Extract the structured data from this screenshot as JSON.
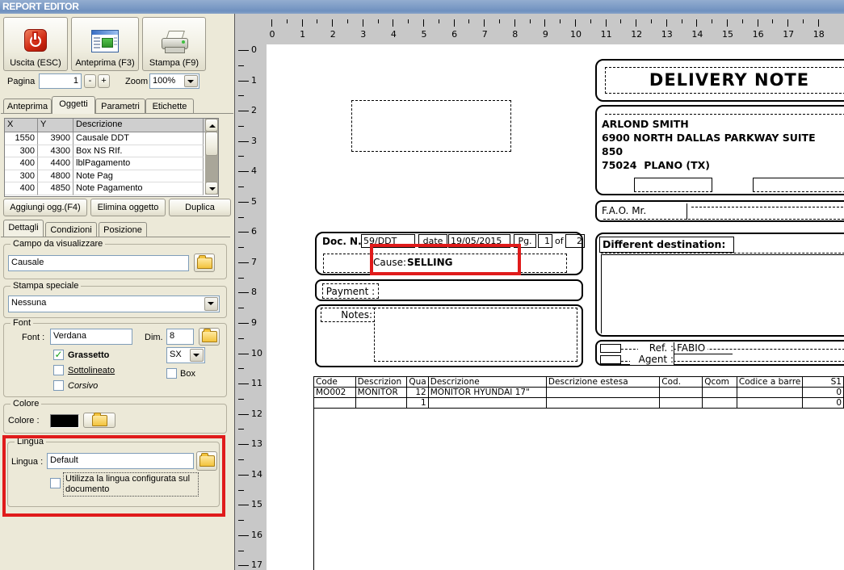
{
  "window": {
    "title": "REPORT EDITOR"
  },
  "toolbar": {
    "buttons": [
      {
        "label": "Uscita (ESC)",
        "icon": "power-icon"
      },
      {
        "label": "Anteprima (F3)",
        "icon": "preview-icon"
      },
      {
        "label": "Stampa (F9)",
        "icon": "printer-icon"
      }
    ]
  },
  "controls": {
    "page_label": "Pagina",
    "page_value": "1",
    "minus_label": "-",
    "plus_label": "+",
    "zoom_label": "Zoom",
    "zoom_value": "100%"
  },
  "object_tabs": {
    "items": [
      "Anteprima",
      "Oggetti",
      "Parametri",
      "Etichette"
    ],
    "active": "Oggetti"
  },
  "objects_table": {
    "columns": [
      "X",
      "Y",
      "Descrizione"
    ],
    "rows": [
      [
        "1550",
        "3900",
        "Causale DDT"
      ],
      [
        "300",
        "4300",
        "Box NS RIf."
      ],
      [
        "400",
        "4400",
        "lblPagamento"
      ],
      [
        "300",
        "4800",
        "Note Pag"
      ],
      [
        "400",
        "4850",
        "Note Pagamento"
      ]
    ]
  },
  "action_buttons": {
    "add": "Aggiungi ogg.(F4)",
    "delete": "Elimina oggetto",
    "duplicate": "Duplica"
  },
  "detail_tabs": {
    "items": [
      "Dettagli",
      "Condizioni",
      "Posizione"
    ],
    "active": "Dettagli"
  },
  "groups": {
    "campo": {
      "title": "Campo da visualizzare",
      "value": "Causale"
    },
    "stampa": {
      "title": "Stampa speciale",
      "value": "Nessuna"
    },
    "font": {
      "title": "Font",
      "font_label": "Font :",
      "font_value": "Verdana",
      "dim_label": "Dim.",
      "dim_value": "8",
      "bold_label": "Grassetto",
      "bold_checked": true,
      "underline_label": "Sottolineato",
      "underline_checked": false,
      "italic_label": "Corsivo",
      "italic_checked": false,
      "align_value": "SX",
      "box_label": "Box",
      "box_checked": false
    },
    "colore": {
      "title": "Colore",
      "label": "Colore :",
      "swatch_color": "#000000"
    },
    "lingua": {
      "title": "Lingua",
      "label": "Lingua :",
      "value": "Default",
      "checkbox_label": "Utilizza la lingua configurata sul documento",
      "checkbox_checked": false
    }
  },
  "rulers": {
    "horizontal_ticks": [
      "0",
      "1",
      "2",
      "3",
      "4",
      "5",
      "6",
      "7",
      "8",
      "9",
      "10",
      "11",
      "12",
      "13",
      "14",
      "15",
      "16",
      "17",
      "18"
    ],
    "vertical_ticks": [
      "0",
      "1",
      "2",
      "3",
      "4",
      "5",
      "6",
      "7",
      "8",
      "9",
      "10",
      "11",
      "12",
      "13",
      "14",
      "15",
      "16",
      "17"
    ]
  },
  "document": {
    "title": "DELIVERY NOTE",
    "address_lines": [
      "ARLOND SMITH",
      "6900 NORTH DALLAS PARKWAY SUITE",
      "850",
      "75024  PLANO (TX)"
    ],
    "fao_label": "F.A.O. Mr.",
    "doc_fields": {
      "doc_n_label": "Doc. N.",
      "doc_n_value": "59/DDT",
      "date_label": "date",
      "date_value": "19/05/2015",
      "pg_label": "Pg.",
      "pg_value": "1",
      "of_label": "of",
      "pg_total": "2",
      "cause_label": "Cause:",
      "cause_value": "SELLING"
    },
    "different_destination_label": "Different destination:",
    "payment_label": "Payment :",
    "notes_label": "Notes:",
    "ref_label": "Ref. :",
    "ref_value": "FABIO",
    "agent_label": "Agent :",
    "items_table": {
      "columns": [
        "Code",
        "Descrizion",
        "Qua",
        "Descrizione",
        "Descrizione estesa",
        "Cod.",
        "Qcom",
        "Codice a barre",
        "S1"
      ],
      "rows": [
        [
          "MO002",
          "MONITOR",
          "12",
          "MONITOR HYUNDAI 17\"",
          "",
          "",
          "",
          "",
          "0"
        ],
        [
          "",
          "",
          "1",
          "",
          "",
          "",
          "",
          "",
          "0"
        ]
      ]
    }
  },
  "colors": {
    "highlight_red": "#e01b1b",
    "titlebar_blue": "#7b9ac5",
    "panel_bg": "#ece9d8",
    "ruler_bg": "#c8c8c8",
    "swatch_black": "#000000"
  }
}
